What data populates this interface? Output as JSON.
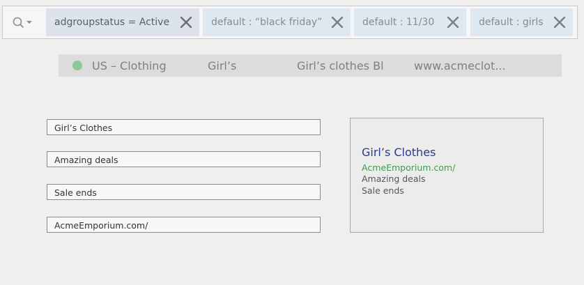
{
  "filter_bar": {
    "search_icon": "magnifier-icon",
    "dropdown_icon": "caret-down-icon",
    "chips": [
      {
        "label": "adgroupstatus = Active",
        "close_icon": "close-icon"
      },
      {
        "label": "default : “black friday”",
        "close_icon": "close-icon"
      },
      {
        "label": "default : 11/30",
        "close_icon": "close-icon"
      },
      {
        "label": "default : girls",
        "close_icon": "close-icon"
      }
    ]
  },
  "ad_group_row": {
    "status_color": "#8fc79d",
    "campaign": "US – Clothing",
    "ad_group": "Girl’s",
    "headline": "Girl’s clothes Bl",
    "display_url": "www.acmeclot..."
  },
  "ad_editor": {
    "headline": "Girl’s Clothes",
    "description_line_1": "Amazing deals",
    "description_line_2": "Sale ends",
    "display_url": "AcmeEmporium.com/"
  },
  "ad_preview": {
    "headline": "Girl’s Clothes",
    "display_url": "AcmeEmporium.com/",
    "description_line_1": "Amazing deals",
    "description_line_2": "Sale ends",
    "headline_color": "#2b3a8c",
    "url_color": "#3f9a4f"
  }
}
